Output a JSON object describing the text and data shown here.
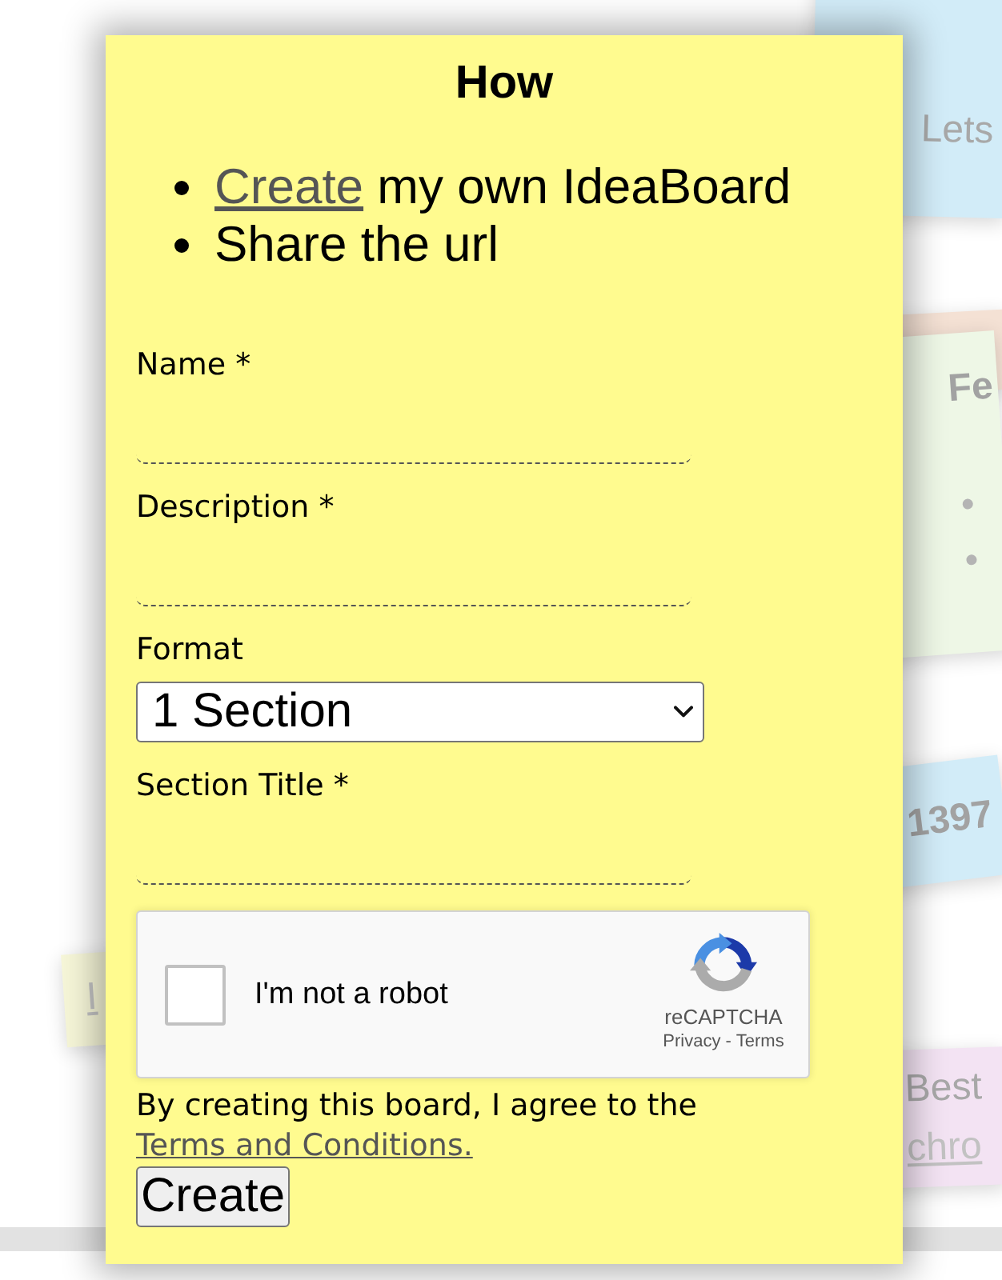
{
  "board_notes": [
    {
      "kind": "plain",
      "color": "#d2ecf8",
      "title": "Lets"
    },
    {
      "color": "#f4e1d4"
    },
    {
      "kind": "heading",
      "color": "#eef7e6",
      "title": "Fe",
      "bullets": [
        "•",
        "•"
      ]
    },
    {
      "kind": "heading",
      "color": "#d2ecf8",
      "title": "1397"
    },
    {
      "kind": "plain",
      "color": "#f3e3f3",
      "title": "Best",
      "link": "chro"
    },
    {
      "color": "#f6f6d8",
      "link": "I"
    }
  ],
  "card": {
    "title": "How",
    "steps": [
      {
        "link": "Create",
        "text": " my own IdeaBoard"
      },
      {
        "text": "Share the url"
      }
    ]
  },
  "form": {
    "fields": [
      {
        "kind": "text",
        "label": "Name *"
      },
      {
        "kind": "text",
        "label": "Description *"
      },
      {
        "kind": "select",
        "label": "Format",
        "value": "1 Section"
      },
      {
        "kind": "text",
        "label": "Section Title *"
      }
    ],
    "captcha": {
      "checked": false,
      "label": "I'm not a robot",
      "brand": "reCAPTCHA",
      "privacy": "Privacy",
      "separator": "-",
      "terms": "Terms"
    },
    "agreement": {
      "text": "By creating this board, I agree to the ",
      "link": "Terms and Conditions."
    },
    "submit": "Create"
  }
}
